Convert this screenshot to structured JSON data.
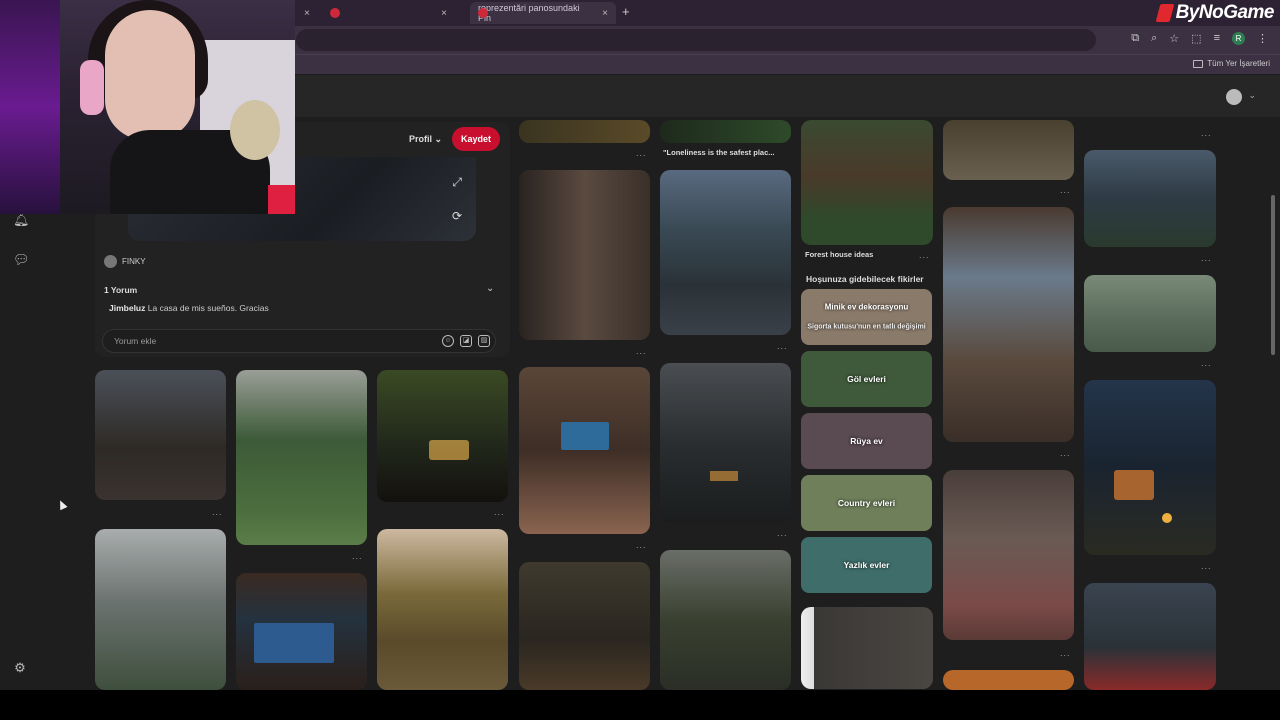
{
  "browser": {
    "tabs": [
      {
        "title": "",
        "active": false
      },
      {
        "title": "",
        "active": false
      },
      {
        "title": "reprezentări panosundaki Pin",
        "active": true
      }
    ],
    "new_tab": "+",
    "close_glyph": "×",
    "brand": "ByNoGame",
    "bookmarks_folder": "Tüm Yer İşaretleri",
    "profile_initial": "R"
  },
  "pin_detail": {
    "profile_label": "Profil",
    "save_label": "Kaydet",
    "author": "FINKY",
    "comments_count": "1 Yorum",
    "comment_author": "Jimbeluz",
    "comment_text": "La casa de mis sueños. Gracias",
    "comment_placeholder": "Yorum ekle"
  },
  "pins": {
    "loneliness_title": "\"Loneliness is the safest plac...",
    "forest_house_title": "Forest house ideas",
    "suggestions_heading": "Hoşunuza gidebilecek fikirler",
    "categories": [
      {
        "label": "Minik ev dekorasyonu",
        "sub": "Sigorta kutusu'nun en tatlı değişimi",
        "color": "#8a7a6a"
      },
      {
        "label": "Göl evleri",
        "color": "#3f5a3a"
      },
      {
        "label": "Rüya ev",
        "color": "#5a4a52"
      },
      {
        "label": "Country evleri",
        "color": "#6e7f5a"
      },
      {
        "label": "Yazlık evler",
        "color": "#3e6d6a"
      }
    ]
  },
  "more_glyph": "..."
}
